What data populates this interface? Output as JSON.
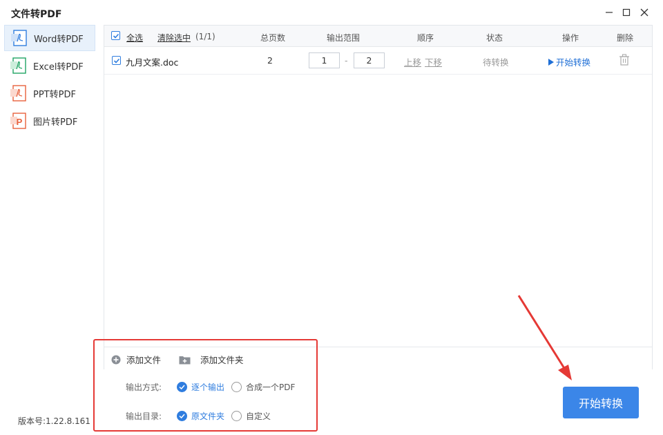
{
  "app": {
    "title": "文件转PDF"
  },
  "sidebar": {
    "items": [
      {
        "label": "Word转PDF",
        "active": true,
        "icon": "word-pdf-icon",
        "color": "#2f7ddf"
      },
      {
        "label": "Excel转PDF",
        "active": false,
        "icon": "excel-pdf-icon",
        "color": "#1fa463"
      },
      {
        "label": "PPT转PDF",
        "active": false,
        "icon": "ppt-pdf-icon",
        "color": "#e8603c"
      },
      {
        "label": "图片转PDF",
        "active": false,
        "icon": "image-pdf-icon",
        "color": "#e8603c"
      }
    ],
    "version": "版本号:1.22.8.161"
  },
  "table": {
    "select_all": "全选",
    "clear_selection": "清除选中",
    "selection_count": "(1/1)",
    "headers": {
      "pages": "总页数",
      "range": "输出范围",
      "order": "顺序",
      "status": "状态",
      "action": "操作",
      "delete": "删除"
    },
    "rows": [
      {
        "checked": true,
        "filename": "九月文案.doc",
        "pages": "2",
        "range_from": "1",
        "range_sep": "-",
        "range_to": "2",
        "move_up": "上移",
        "move_down": "下移",
        "status": "待转换",
        "action": "开始转换"
      }
    ]
  },
  "toolbar": {
    "add_file": "添加文件",
    "add_folder": "添加文件夹"
  },
  "output": {
    "mode_label": "输出方式:",
    "mode_options": [
      {
        "label": "逐个输出",
        "selected": true
      },
      {
        "label": "合成一个PDF",
        "selected": false
      }
    ],
    "dir_label": "输出目录:",
    "dir_options": [
      {
        "label": "原文件夹",
        "selected": true
      },
      {
        "label": "自定义",
        "selected": false
      }
    ]
  },
  "start_button": "开始转换",
  "colors": {
    "accent": "#2f7ddf",
    "button": "#3b86e8",
    "annotation": "#e53935"
  }
}
